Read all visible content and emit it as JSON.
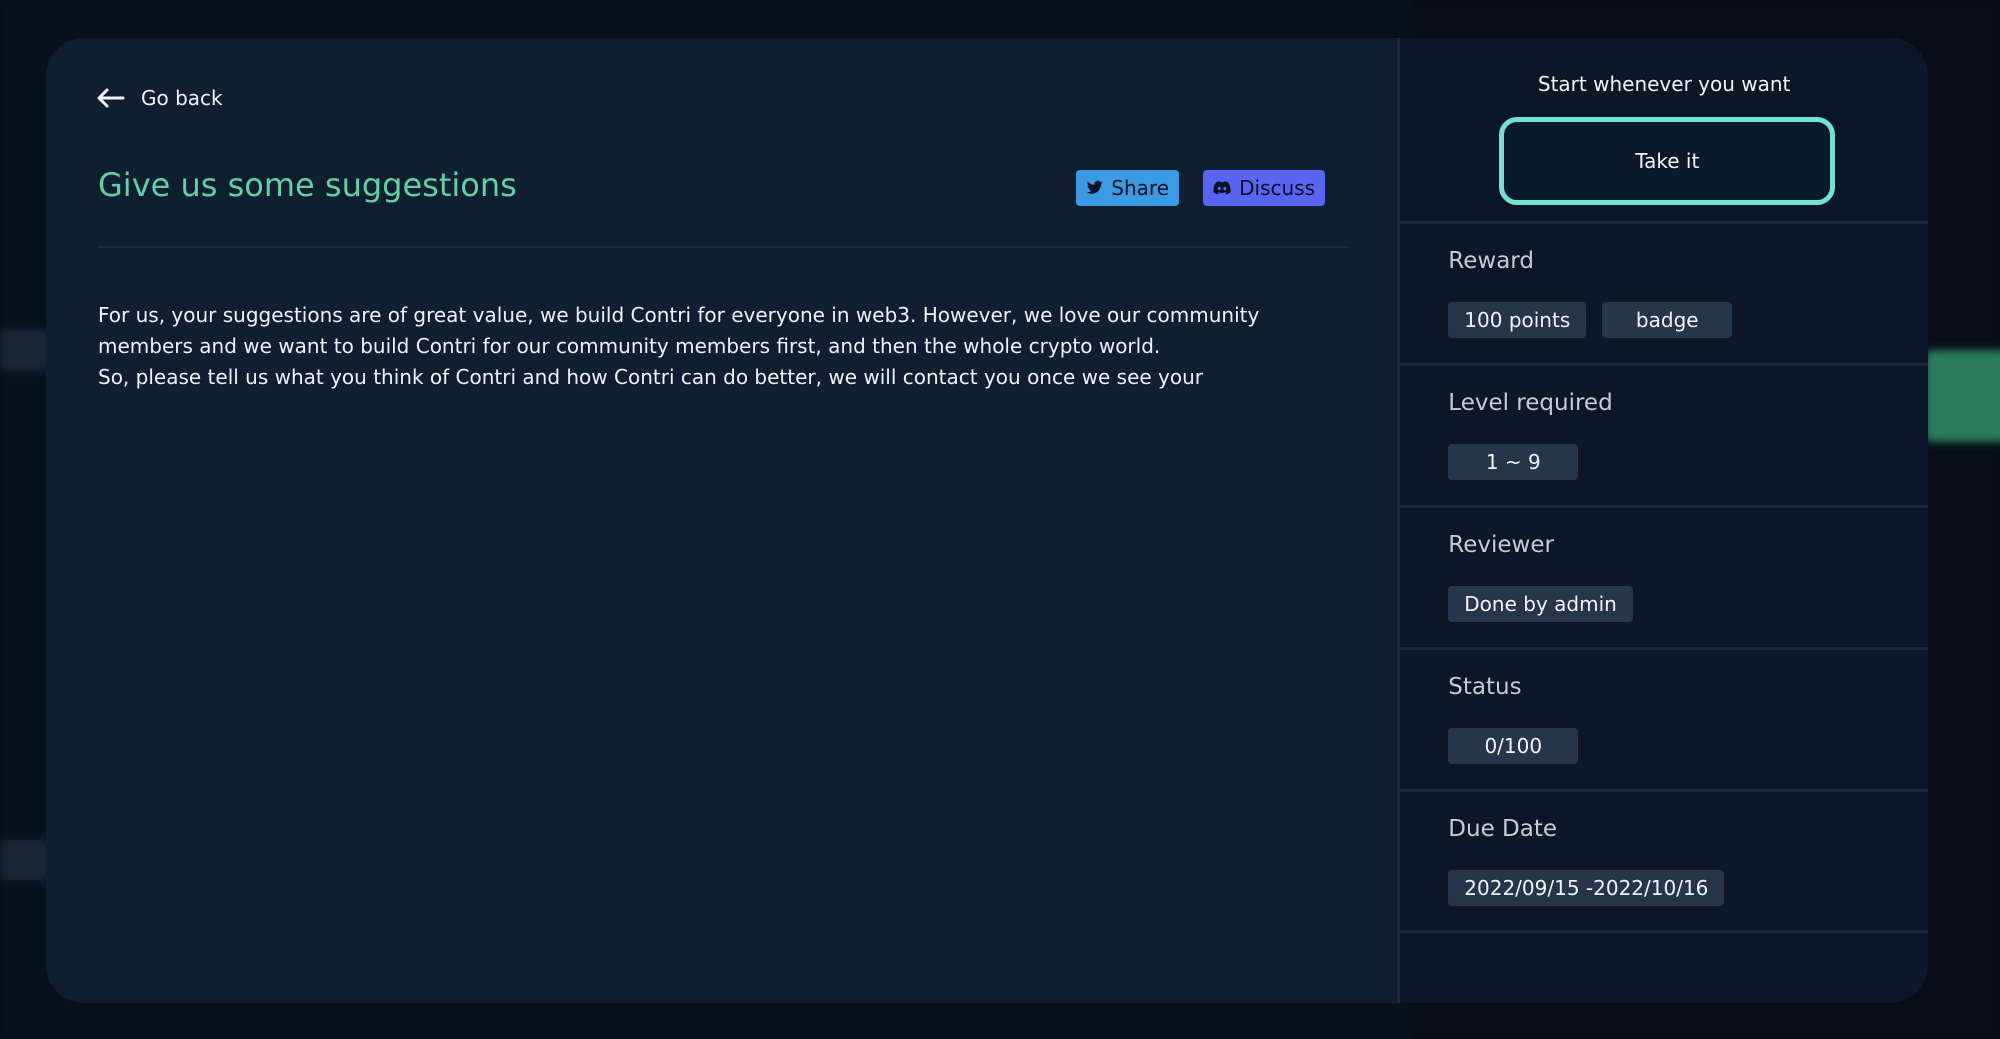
{
  "header": {
    "back_label": "Go back"
  },
  "task": {
    "title": "Give us some suggestions",
    "share_label": "Share",
    "discuss_label": "Discuss",
    "description": [
      "For us, your suggestions are of great value, we build Contri for everyone in web3. However, we love our community members and we want to build Contri for our community members first, and then the whole crypto world.",
      "So, please tell us what you think of Contri and how Contri can do better, we will contact you once we see your"
    ]
  },
  "sidebar": {
    "start_label": "Start whenever you want",
    "take_label": "Take it",
    "reward": {
      "title": "Reward",
      "items": [
        "100 points",
        "badge"
      ]
    },
    "level": {
      "title": "Level required",
      "value": "1 ~ 9"
    },
    "reviewer": {
      "title": "Reviewer",
      "value": "Done by admin"
    },
    "status": {
      "title": "Status",
      "value": "0/100"
    },
    "due": {
      "title": "Due Date",
      "value": "2022/09/15 -2022/10/16"
    }
  },
  "colors": {
    "title_accent": "#5fd2a4",
    "take_border": "#71e3cf",
    "share_bg": "#3b9ae4",
    "discuss_bg": "#5865f2",
    "chip_bg": "#25364a"
  }
}
